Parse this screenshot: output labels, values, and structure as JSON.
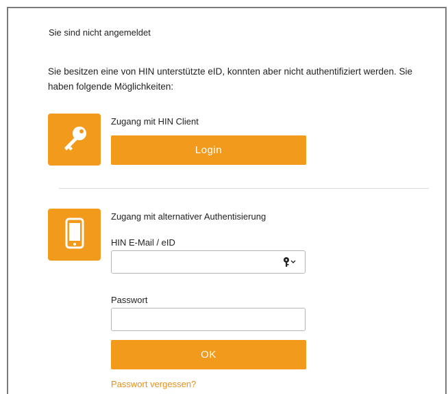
{
  "page": {
    "heading": "Sie sind nicht angemeldet",
    "intro": "Sie besitzen eine von HIN unterstützte eID, konnten aber nicht authentifiziert werden. Sie haben folgende Möglichkeiten:"
  },
  "client_section": {
    "icon": "key-icon",
    "title": "Zugang mit HIN Client",
    "button_label": "Login"
  },
  "alt_section": {
    "icon": "smartphone-icon",
    "title": "Zugang mit alternativer Authentisierung",
    "email_label": "HIN E-Mail / eID",
    "email_value": "",
    "email_helper_icon": "key-dropdown-icon",
    "password_label": "Passwort",
    "password_value": "",
    "ok_label": "OK",
    "forgot_link": "Passwort vergessen?"
  },
  "colors": {
    "accent": "#f29a1c",
    "link": "#e5901a",
    "frame_border": "#7a7a7a"
  }
}
